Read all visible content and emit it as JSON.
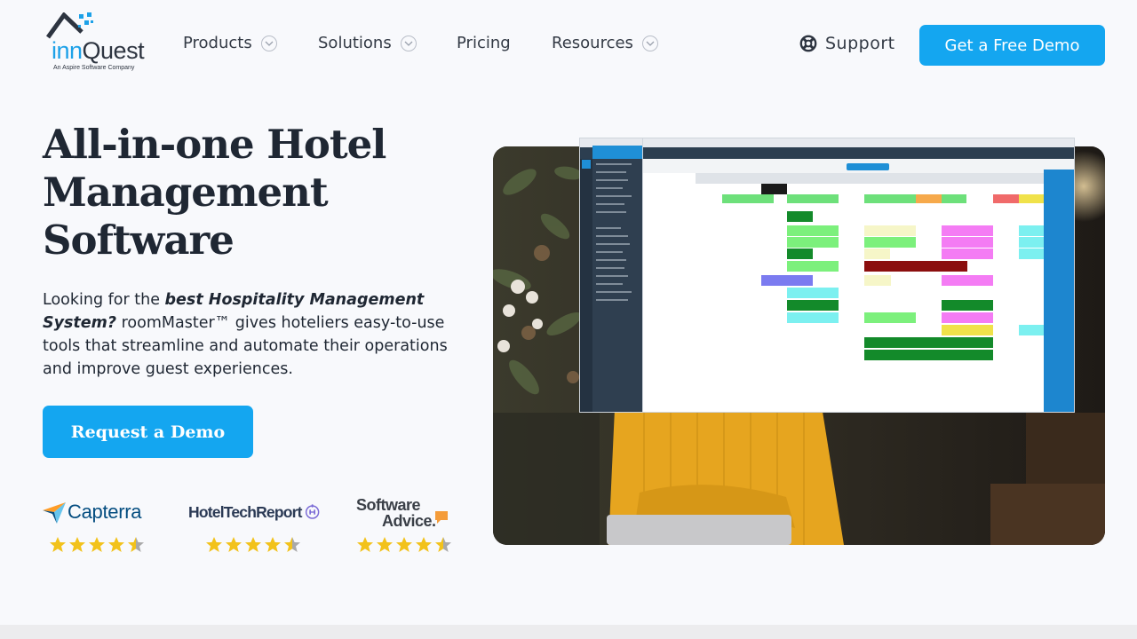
{
  "logo": {
    "word_part1": "inn",
    "word_part2": "Quest",
    "tagline": "An Aspire Software Company"
  },
  "nav": {
    "items": [
      {
        "label": "Products",
        "has_dropdown": true
      },
      {
        "label": "Solutions",
        "has_dropdown": true
      },
      {
        "label": "Pricing",
        "has_dropdown": false
      },
      {
        "label": "Resources",
        "has_dropdown": true
      }
    ],
    "support_label": "Support",
    "cta_label": "Get a Free Demo"
  },
  "hero": {
    "title_line1": "All-in-one Hotel",
    "title_line2": "Management",
    "title_line3": "Software",
    "text_lead": "Looking for the ",
    "text_emphasis": "best Hospitality Management System?",
    "text_rest": " roomMaster™ gives hoteliers easy-to-use tools that streamline and automate their operations and improve guest experiences.",
    "cta_label": "Request a Demo"
  },
  "reviews": [
    {
      "brand": "Capterra",
      "rating": 4.5
    },
    {
      "brand": "HotelTechReport",
      "rating": 4.5
    },
    {
      "brand_line1": "Software",
      "brand_line2": "Advice.",
      "rating": 4.5
    }
  ],
  "colors": {
    "accent": "#14a6f0",
    "text": "#1f2733",
    "background": "#f8f9fc",
    "star": "#f2c21b"
  },
  "icons": {
    "dropdown": "chevron-down-icon",
    "support": "lifebuoy-icon",
    "star": "star-icon"
  }
}
